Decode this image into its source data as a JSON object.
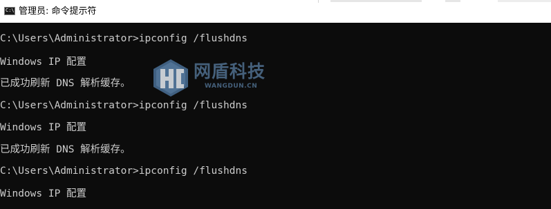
{
  "window": {
    "title": "管理员: 命令提示符",
    "icon": "cmd-console-icon",
    "icon_text": "C:\\."
  },
  "console": {
    "lines": [
      "C:\\Users\\Administrator>ipconfig /flushdns",
      "Windows IP 配置",
      "已成功刷新 DNS 解析缓存。",
      "C:\\Users\\Administrator>ipconfig /flushdns",
      "Windows IP 配置",
      "已成功刷新 DNS 解析缓存。",
      "C:\\Users\\Administrator>ipconfig /flushdns",
      "Windows IP 配置"
    ]
  },
  "watermark": {
    "logo": "wangdun-logo-icon",
    "name_cn": "网盾科技",
    "name_en": "WANGDUN.CN"
  },
  "colors": {
    "console_bg": "#0c0c0c",
    "console_text": "#cccccc",
    "titlebar_bg": "#ffffff",
    "watermark": "#4f6f8f"
  }
}
